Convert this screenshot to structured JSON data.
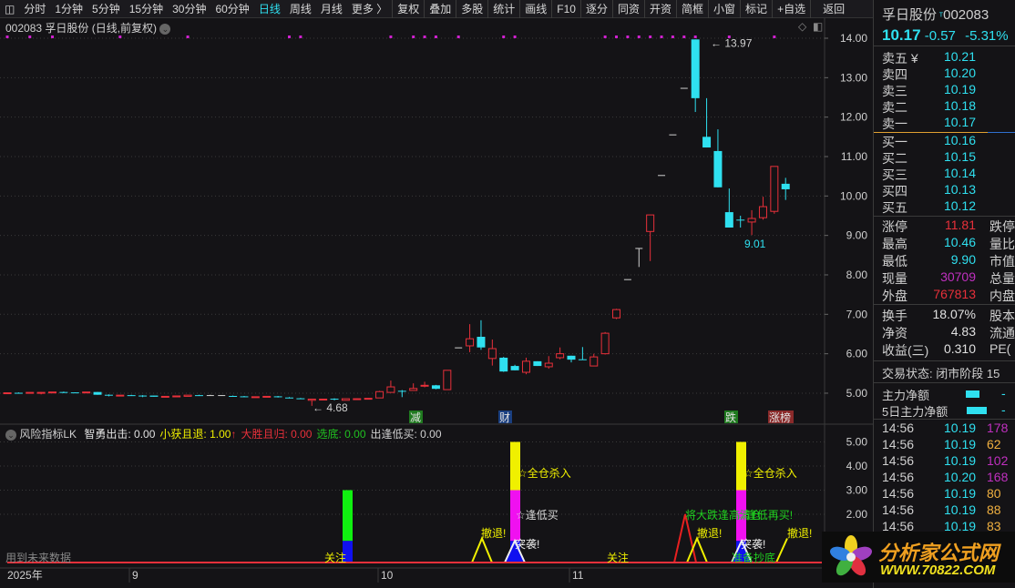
{
  "toolbar": {
    "items": [
      "分时",
      "1分钟",
      "5分钟",
      "15分钟",
      "30分钟",
      "60分钟",
      "日线",
      "周线",
      "月线",
      "更多 〉"
    ],
    "active": "日线",
    "buttons": [
      "复权",
      "叠加",
      "多股",
      "统计",
      "画线",
      "F10",
      "逐分",
      "同资",
      "开资",
      "简框",
      "小窗",
      "标记",
      "+自选",
      "返回"
    ]
  },
  "chart": {
    "title": "002083 孚日股份 (日线,前复权)",
    "yaxis": [
      "14.00",
      "13.00",
      "12.00",
      "11.00",
      "10.00",
      "9.00",
      "8.00",
      "7.00",
      "6.00",
      "5.00"
    ],
    "high_label": "13.97",
    "low_label": "9.01",
    "low2_label": "4.68",
    "markers": [
      {
        "text": "减",
        "bg": "#1f7a1f"
      },
      {
        "text": "财",
        "bg": "#1a3f80"
      },
      {
        "text": "跌",
        "bg": "#1f7a1f"
      },
      {
        "text": "涨榜",
        "bg": "#8a2a2a"
      }
    ],
    "kline": [
      [
        4.99,
        5.02,
        4.99,
        5.01
      ],
      [
        5.01,
        5.02,
        4.99,
        5.0
      ],
      [
        5.0,
        5.02,
        5.0,
        5.02
      ],
      [
        5.0,
        5.03,
        4.97,
        5.02
      ],
      [
        5.02,
        5.03,
        5.02,
        5.03
      ],
      [
        5.03,
        5.04,
        5.0,
        5.01
      ],
      [
        5.02,
        5.02,
        5.0,
        5.01
      ],
      [
        5.01,
        5.03,
        5.01,
        5.03
      ],
      [
        5.03,
        5.03,
        4.96,
        4.96
      ],
      [
        4.96,
        4.97,
        4.92,
        4.95
      ],
      [
        4.93,
        4.95,
        4.93,
        4.95
      ],
      [
        4.95,
        4.96,
        4.93,
        4.94
      ],
      [
        4.94,
        4.95,
        4.9,
        4.93
      ],
      [
        4.94,
        4.94,
        4.91,
        4.91
      ],
      [
        4.9,
        4.92,
        4.9,
        4.92
      ],
      [
        4.92,
        4.93,
        4.92,
        4.93
      ],
      [
        4.92,
        4.95,
        4.92,
        4.95
      ],
      [
        4.95,
        4.96,
        4.94,
        4.94
      ],
      [
        4.94,
        4.96,
        4.93,
        4.94
      ],
      [
        4.94,
        4.95,
        4.93,
        4.94
      ],
      [
        4.93,
        4.94,
        4.92,
        4.92
      ],
      [
        4.92,
        4.93,
        4.9,
        4.91
      ],
      [
        4.89,
        4.91,
        4.89,
        4.91
      ],
      [
        4.91,
        4.92,
        4.91,
        4.92
      ],
      [
        4.92,
        4.93,
        4.89,
        4.9
      ],
      [
        4.89,
        4.9,
        4.87,
        4.87
      ],
      [
        4.87,
        4.88,
        4.85,
        4.86
      ],
      [
        4.82,
        4.85,
        4.68,
        4.85
      ],
      [
        4.83,
        4.85,
        4.83,
        4.85
      ],
      [
        4.86,
        4.87,
        4.82,
        4.84
      ],
      [
        4.82,
        4.86,
        4.82,
        4.86
      ],
      [
        4.84,
        4.87,
        4.84,
        4.86
      ],
      [
        4.85,
        4.87,
        4.84,
        4.87
      ],
      [
        4.88,
        5.06,
        4.88,
        5.04
      ],
      [
        5.02,
        5.32,
        5.02,
        5.16
      ],
      [
        5.06,
        5.08,
        4.9,
        5.05
      ],
      [
        5.07,
        5.25,
        5.07,
        5.12
      ],
      [
        5.19,
        5.29,
        5.15,
        5.2
      ],
      [
        5.2,
        5.21,
        5.1,
        5.11
      ],
      [
        5.09,
        5.58,
        5.09,
        5.58
      ],
      [
        6.15,
        6.15,
        6.15,
        6.15
      ],
      [
        6.2,
        6.75,
        6.04,
        6.38
      ],
      [
        6.43,
        6.85,
        6.1,
        6.16
      ],
      [
        5.88,
        6.36,
        5.7,
        6.13
      ],
      [
        5.9,
        5.92,
        5.54,
        5.55
      ],
      [
        5.69,
        5.72,
        5.58,
        5.58
      ],
      [
        5.53,
        5.9,
        5.48,
        5.81
      ],
      [
        5.81,
        5.81,
        5.69,
        5.69
      ],
      [
        5.67,
        5.94,
        5.62,
        5.76
      ],
      [
        5.9,
        6.16,
        5.86,
        6.0
      ],
      [
        5.95,
        5.95,
        5.78,
        5.85
      ],
      [
        5.86,
        6.17,
        5.85,
        5.85
      ],
      [
        5.69,
        6.0,
        5.69,
        5.92
      ],
      [
        6.0,
        6.55,
        5.98,
        6.52
      ],
      [
        6.91,
        7.14,
        6.88,
        7.12
      ],
      [
        7.88,
        7.88,
        7.88,
        7.88
      ],
      [
        8.67,
        8.67,
        8.2,
        8.67
      ],
      [
        9.1,
        9.52,
        8.35,
        9.52
      ],
      [
        10.52,
        10.52,
        10.52,
        10.52
      ],
      [
        11.55,
        11.55,
        11.55,
        11.55
      ],
      [
        12.73,
        12.73,
        12.73,
        12.73
      ],
      [
        13.97,
        13.97,
        12.13,
        12.48
      ],
      [
        11.5,
        12.48,
        11.23,
        11.23
      ],
      [
        11.14,
        11.69,
        10.22,
        10.22
      ],
      [
        9.59,
        10.19,
        9.2,
        9.2
      ],
      [
        9.4,
        9.5,
        9.2,
        9.38
      ],
      [
        9.34,
        9.64,
        9.01,
        9.43
      ],
      [
        9.45,
        9.98,
        9.4,
        9.73
      ],
      [
        9.61,
        10.75,
        9.55,
        10.75
      ],
      [
        10.31,
        10.46,
        9.9,
        10.17
      ]
    ],
    "dots": [
      0,
      2,
      4,
      10,
      16,
      25,
      26,
      34,
      36,
      37,
      38,
      40,
      44,
      45,
      53,
      54,
      55,
      56,
      57,
      58,
      59,
      60,
      61,
      64,
      68
    ]
  },
  "indicator": {
    "name": "风险指标LK",
    "fields": [
      {
        "label": "智勇出击: 0.00",
        "color": "#e0e0e0"
      },
      {
        "label": "小获且退: 1.00",
        "color": "#f0f000"
      },
      {
        "label": "↑",
        "color": "#e8303a"
      },
      {
        "label": "大胜且归: 0.00",
        "color": "#e8303a"
      },
      {
        "label": "选底: 0.00",
        "color": "#20c020"
      },
      {
        "label": "出逢低买: 0.00",
        "color": "#d0d0d0"
      }
    ],
    "yaxis": [
      "5.00",
      "4.00",
      "3.00",
      "2.00"
    ],
    "future_note": "用到未来数据",
    "labels": {
      "retreat": "撤退!",
      "all_in": "☆全仓杀入",
      "buy_low": "☆逢低买",
      "raid": "突袭!",
      "watch": "关注",
      "warn": "将大跌逢高清仓",
      "buy_again": "☆逢低再买!",
      "bottom": "准备抄底"
    },
    "xaxis": [
      "2025年",
      "9",
      "10",
      "11"
    ]
  },
  "panel": {
    "name": "孚日股份",
    "code": "002083",
    "price": "10.17",
    "change": "-0.57",
    "pct": "-5.31%",
    "asks": [
      {
        "l": "卖五 ¥",
        "v": "10.21"
      },
      {
        "l": "卖四",
        "v": "10.20"
      },
      {
        "l": "卖三",
        "v": "10.19"
      },
      {
        "l": "卖二",
        "v": "10.18"
      },
      {
        "l": "卖一",
        "v": "10.17"
      }
    ],
    "bids": [
      {
        "l": "买一",
        "v": "10.16"
      },
      {
        "l": "买二",
        "v": "10.15"
      },
      {
        "l": "买三",
        "v": "10.14"
      },
      {
        "l": "买四",
        "v": "10.13"
      },
      {
        "l": "买五",
        "v": "10.12"
      }
    ],
    "stats": [
      {
        "l": "涨停",
        "v": "11.81",
        "c": "rd",
        "r": "跌停"
      },
      {
        "l": "最高",
        "v": "10.46",
        "c": "cy",
        "r": "量比"
      },
      {
        "l": "最低",
        "v": "9.90",
        "c": "cy",
        "r": "市值"
      },
      {
        "l": "现量",
        "v": "30709",
        "c": "mg",
        "r": "总量"
      },
      {
        "l": "外盘",
        "v": "767813",
        "c": "rd",
        "r": "内盘"
      }
    ],
    "stats2": [
      {
        "l": "换手",
        "v": "18.07%",
        "r": "股本"
      },
      {
        "l": "净资",
        "v": "4.83",
        "r": "流通"
      },
      {
        "l": "收益(三)",
        "v": "0.310",
        "r": "PE("
      }
    ],
    "status": "交易状态: 闭市阶段 15",
    "flows": [
      {
        "l": "主力净额",
        "v": "-"
      },
      {
        "l": "5日主力净额",
        "v": "-"
      }
    ],
    "ticks": [
      {
        "t": "14:56",
        "p": "10.19",
        "q": "178",
        "c": "mg"
      },
      {
        "t": "14:56",
        "p": "10.19",
        "q": "62",
        "c": "or"
      },
      {
        "t": "14:56",
        "p": "10.19",
        "q": "102",
        "c": "mg"
      },
      {
        "t": "14:56",
        "p": "10.20",
        "q": "168",
        "c": "mg"
      },
      {
        "t": "14:56",
        "p": "10.19",
        "q": "80",
        "c": "or"
      },
      {
        "t": "14:56",
        "p": "10.19",
        "q": "88",
        "c": "or"
      },
      {
        "t": "14:56",
        "p": "10.19",
        "q": "83",
        "c": "or"
      }
    ]
  },
  "watermark": {
    "title": "分析家公式网",
    "url": "WWW.70822.COM"
  }
}
